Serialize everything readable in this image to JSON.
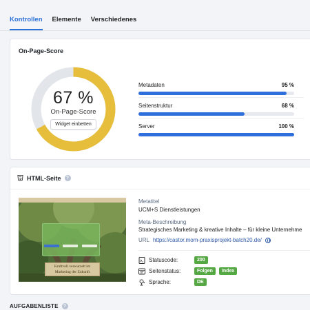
{
  "tabs": [
    {
      "label": "Kontrollen",
      "active": true
    },
    {
      "label": "Elemente",
      "active": false
    },
    {
      "label": "Verschiedenes",
      "active": false
    }
  ],
  "score_card": {
    "title": "On-Page-Score",
    "score": "67 %",
    "score_value": 67,
    "score_label": "On-Page-Score",
    "widget_button": "Widget einbetten",
    "metrics": [
      {
        "label": "Metadaten",
        "value": "95 %",
        "fraction": 0.95
      },
      {
        "label": "Seitenstruktur",
        "value": "68 %",
        "fraction": 0.68
      },
      {
        "label": "Server",
        "value": "100 %",
        "fraction": 1.0
      }
    ],
    "colors": {
      "score_ring": "#e6be3c",
      "ring_track": "#e2e5ea",
      "bar_fill": "#2f6fdc"
    }
  },
  "html_card": {
    "title": "HTML-Seite",
    "info_icon": "info-icon",
    "thumbnail": {
      "banner_line1": "Kraftvoll verwurzelt im",
      "banner_line2": "Marketing der Zukunft"
    },
    "meta_title_label": "Metatitel",
    "meta_title": "UCM+S Dienstleistungen",
    "meta_description_label": "Meta-Beschreibung",
    "meta_description": "Strategisches Marketing & kreative Inhalte – für kleine Unternehme",
    "url_label": "URL",
    "url": "https://castor.mom-praxisprojekt-batch20.de/",
    "status_code_label": "Statuscode:",
    "status_code": "200",
    "page_status_label": "Seitenstatus:",
    "page_status_badges": [
      "Folgen",
      "Index"
    ],
    "language_label": "Sprache:",
    "language": "DE"
  },
  "tasks": {
    "title": "AUFGABENLISTE"
  }
}
